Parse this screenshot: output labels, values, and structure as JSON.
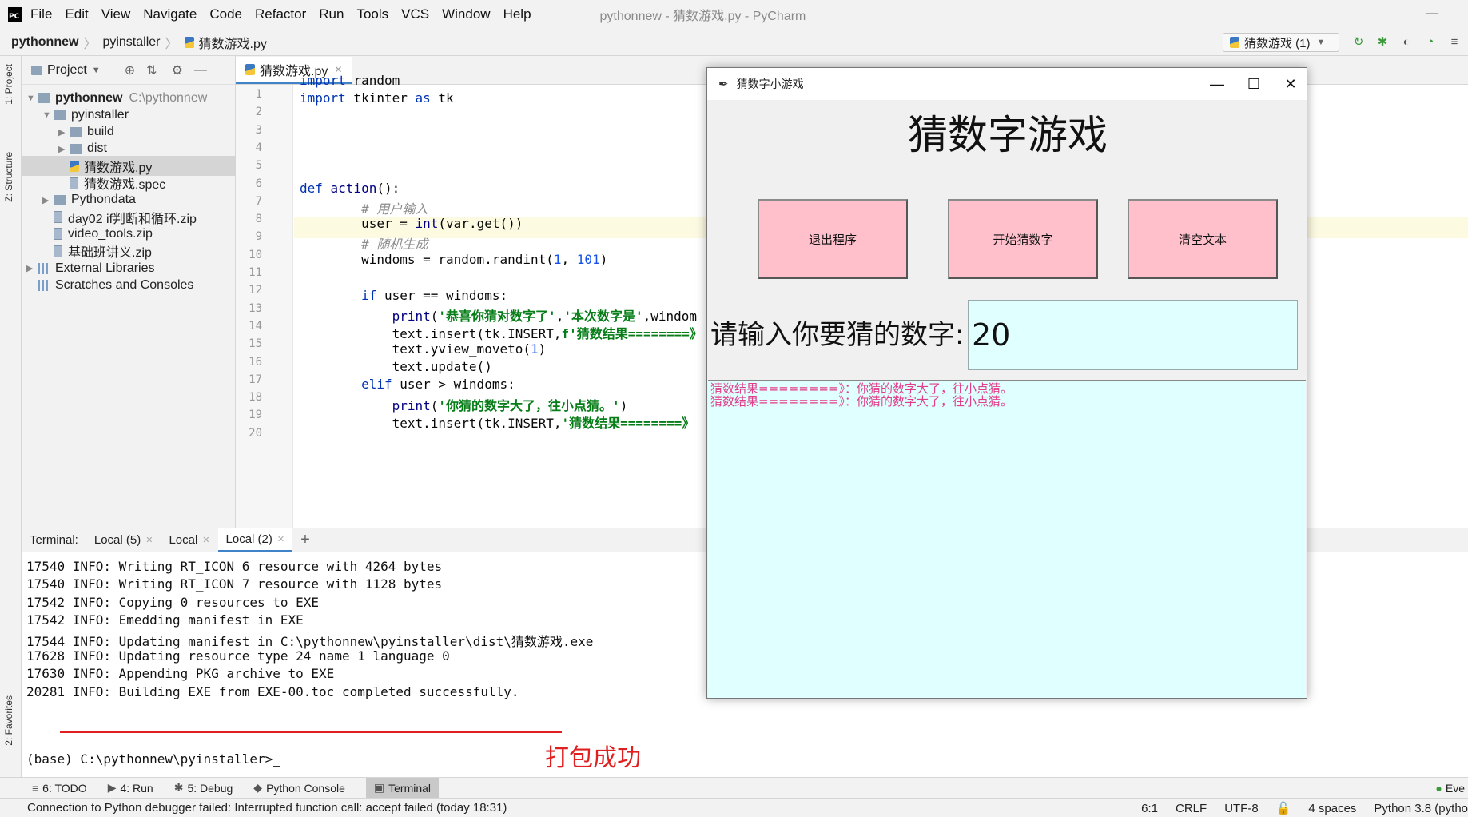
{
  "app": {
    "window_title": "pythonnew - 猜数游戏.py - PyCharm",
    "logo": "PC",
    "minimize_glyph": "—"
  },
  "menu": [
    "File",
    "Edit",
    "View",
    "Navigate",
    "Code",
    "Refactor",
    "Run",
    "Tools",
    "VCS",
    "Window",
    "Help"
  ],
  "navbar": {
    "crumbs": [
      "pythonnew",
      "pyinstaller",
      "猜数游戏.py"
    ],
    "run_config": "猜数游戏 (1)"
  },
  "left_strip": {
    "project_tab": "1: Project",
    "structure_tab": "Z: Structure",
    "favorites_tab": "2: Favorites"
  },
  "project_panel": {
    "title": "Project",
    "tree": [
      {
        "label": "pythonnew",
        "extra": "C:\\pythonnew",
        "type": "folder",
        "depth": 0,
        "arrow": "▼"
      },
      {
        "label": "pyinstaller",
        "type": "folder",
        "depth": 1,
        "arrow": "▼"
      },
      {
        "label": "build",
        "type": "folder",
        "depth": 2,
        "arrow": "▶"
      },
      {
        "label": "dist",
        "type": "folder",
        "depth": 2,
        "arrow": "▶"
      },
      {
        "label": "猜数游戏.py",
        "type": "py",
        "depth": 2,
        "arrow": ""
      },
      {
        "label": "猜数游戏.spec",
        "type": "zip",
        "depth": 2,
        "arrow": ""
      },
      {
        "label": "Pythondata",
        "type": "folder",
        "depth": 1,
        "arrow": "▶"
      },
      {
        "label": "day02 if判断和循环.zip",
        "type": "zip",
        "depth": 1,
        "arrow": ""
      },
      {
        "label": "video_tools.zip",
        "type": "zip",
        "depth": 1,
        "arrow": ""
      },
      {
        "label": "基础班讲义.zip",
        "type": "zip",
        "depth": 1,
        "arrow": ""
      },
      {
        "label": "External Libraries",
        "type": "lib",
        "depth": 0,
        "arrow": "▶"
      },
      {
        "label": "Scratches and Consoles",
        "type": "lib",
        "depth": 0,
        "arrow": ""
      }
    ]
  },
  "editor": {
    "tab_label": "猜数游戏.py",
    "line_numbers": [
      "1",
      "2",
      "3",
      "4",
      "5",
      "6",
      "7",
      "8",
      "9",
      "10",
      "11",
      "12",
      "13",
      "14",
      "15",
      "16",
      "17",
      "18",
      "19",
      "20"
    ]
  },
  "terminal": {
    "tabs": [
      "Terminal:",
      "Local (5)",
      "Local",
      "Local (2)",
      "+"
    ],
    "lines": [
      "17540 INFO: Writing RT_ICON 6 resource with 4264 bytes",
      "17540 INFO: Writing RT_ICON 7 resource with 1128 bytes",
      "17542 INFO: Copying 0 resources to EXE",
      "17542 INFO: Emedding manifest in EXE",
      "17544 INFO: Updating manifest in C:\\pythonnew\\pyinstaller\\dist\\猜数游戏.exe",
      "17628 INFO: Updating resource type 24 name 1 language 0",
      "17630 INFO: Appending PKG archive to EXE",
      "20281 INFO: Building EXE from EXE-00.toc completed successfully."
    ],
    "prompt": "(base) C:\\pythonnew\\pyinstaller>",
    "annotation": "打包成功"
  },
  "bottom_tools": [
    {
      "icon": "≡",
      "label": "6: TODO"
    },
    {
      "icon": "▶",
      "label": "4: Run"
    },
    {
      "icon": "✱",
      "label": "5: Debug"
    },
    {
      "icon": "◆",
      "label": "Python Console"
    },
    {
      "icon": "▣",
      "label": "Terminal"
    }
  ],
  "bottom_right": "Eve",
  "status": {
    "message": "Connection to Python debugger failed: Interrupted function call: accept failed (today 18:31)",
    "position": "6:1",
    "line_sep": "CRLF",
    "encoding": "UTF-8",
    "indent": "4 spaces",
    "interpreter": "Python 3.8 (pytho"
  },
  "game": {
    "title": "猜数字小游戏",
    "heading": "猜数字游戏",
    "buttons": [
      "退出程序",
      "开始猜数字",
      "清空文本"
    ],
    "label": "请输入你要猜的数字:",
    "input_value": "20",
    "results": [
      "猜数结果========》：你猜的数字大了，往小点猜。",
      "猜数结果========》：你猜的数字大了，往小点猜。"
    ],
    "controls": {
      "minimize": "—",
      "maximize": "☐",
      "close": "✕"
    }
  },
  "colors": {
    "button_bg": "#ffc0cb",
    "entry_bg": "#e0ffff",
    "result_text": "#e23c8a",
    "annotation": "#e02020",
    "accent": "#4083c9"
  }
}
